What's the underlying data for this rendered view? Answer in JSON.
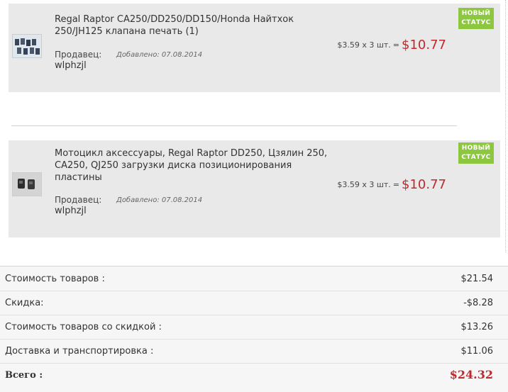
{
  "items": [
    {
      "title": "Regal Raptor CA250/DD250/DD150/Honda Найтхок 250/JH125 клапана печать (1)",
      "seller_label": "Продавец:",
      "added": "Добавлено: 07.08.2014",
      "seller_name": "wlphzjl",
      "price_calc": "$3.59 x 3 шт.",
      "price_eq": "=",
      "price_total": "$10.77",
      "badge_line1": "НОВЫЙ",
      "badge_line2": "СТАТУС"
    },
    {
      "title": "Мотоцикл аксессуары, Regal Raptor DD250, Цзялин 250, CA250, QJ250 загрузки диска позиционирования пластины",
      "seller_label": "Продавец:",
      "added": "Добавлено: 07.08.2014",
      "seller_name": "wlphzjl",
      "price_calc": "$3.59 x 3 шт.",
      "price_eq": "=",
      "price_total": "$10.77",
      "badge_line1": "НОВЫЙ",
      "badge_line2": "СТАТУС"
    }
  ],
  "summary": {
    "rows": [
      {
        "label": "Стоимость товаров :",
        "value": "$21.54"
      },
      {
        "label": "Скидка:",
        "value": "-$8.28"
      },
      {
        "label": "Стоимость товаров со скидкой :",
        "value": "$13.26"
      },
      {
        "label": "Доставка и транспортировка :",
        "value": "$11.06"
      },
      {
        "label": "Всего :",
        "value": "$24.32"
      }
    ]
  },
  "colors": {
    "badge": "#8dc63f",
    "price": "#c0282d",
    "item_bg": "#e9e9e9"
  }
}
